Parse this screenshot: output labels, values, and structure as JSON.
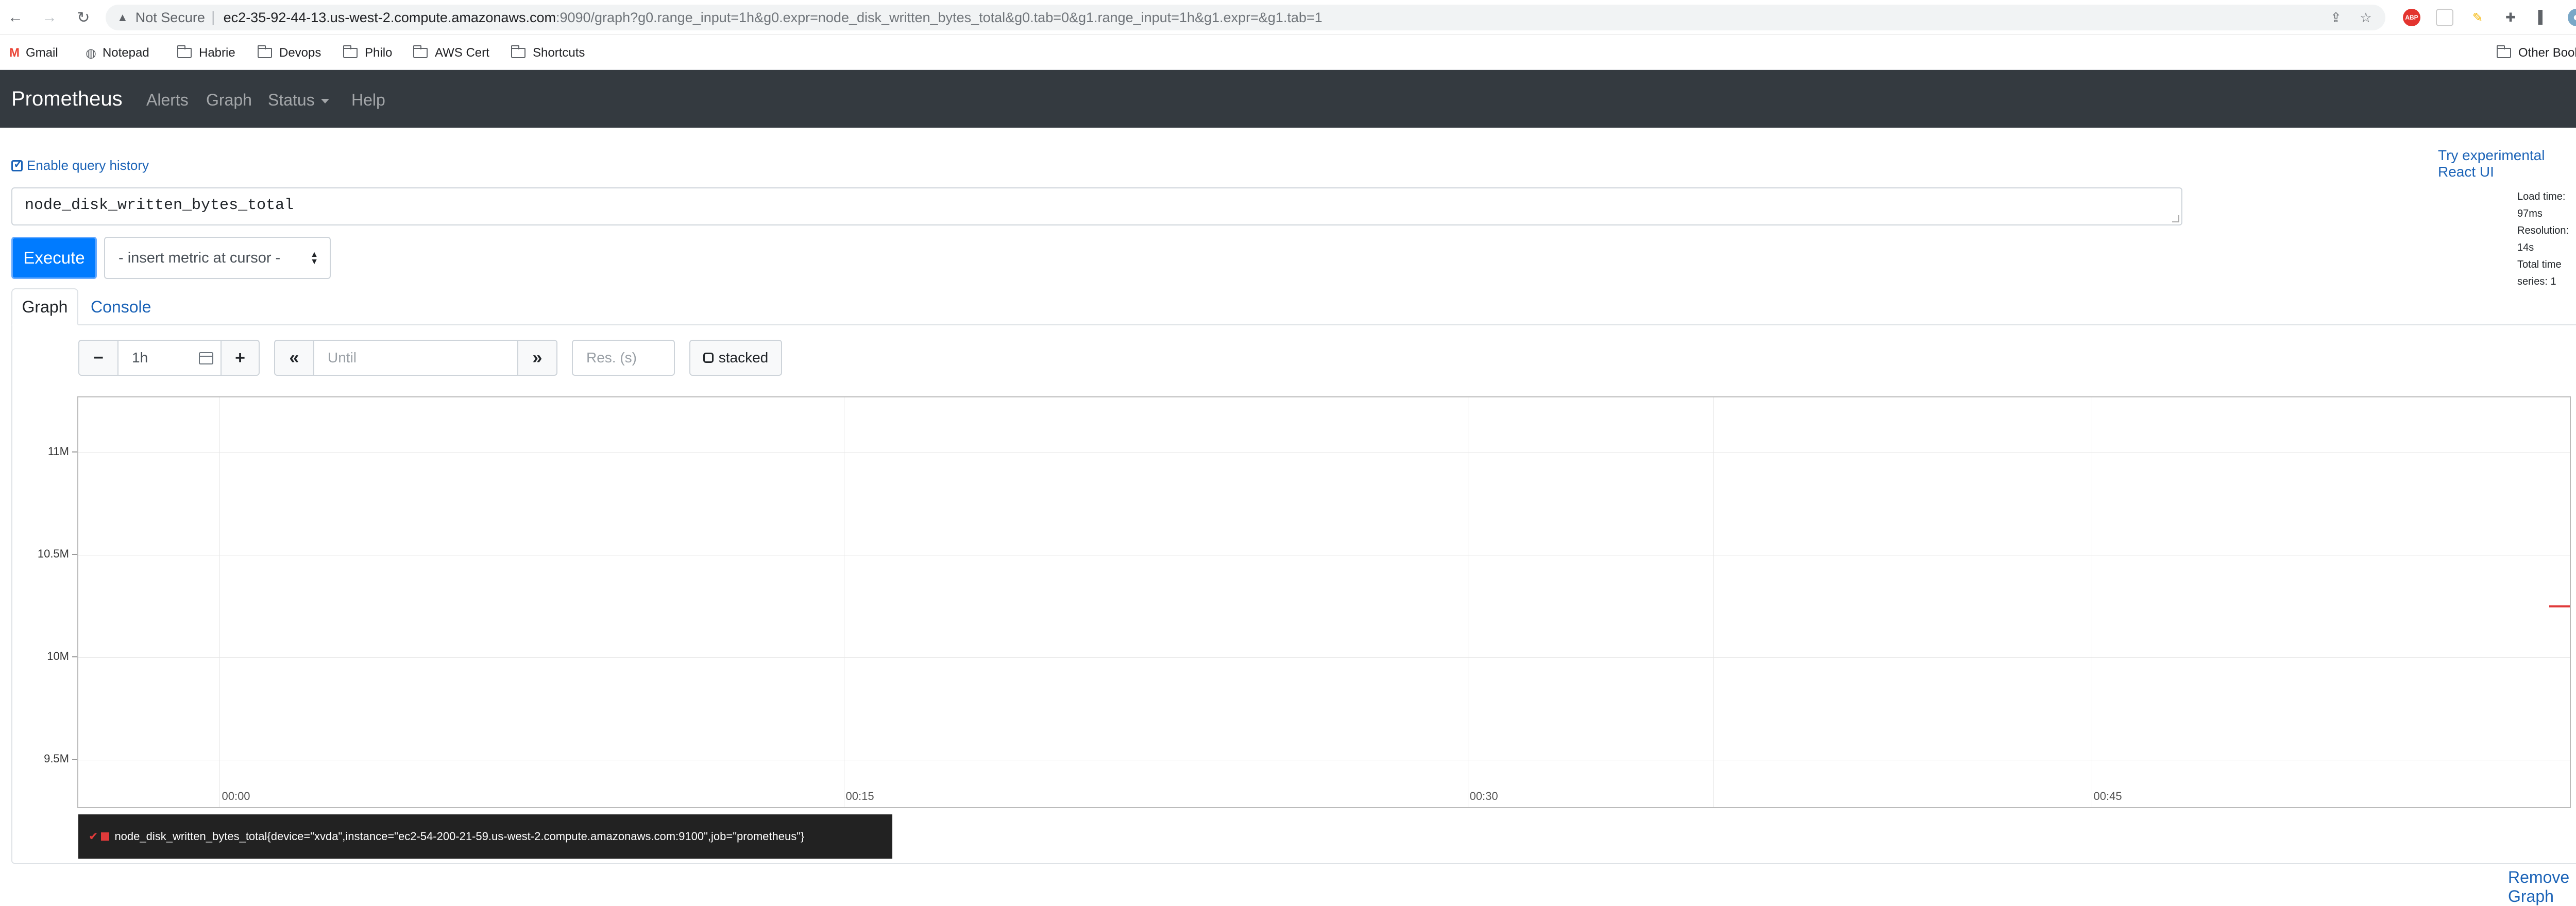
{
  "browser": {
    "security_label": "Not Secure",
    "url_host": "ec2-35-92-44-13.us-west-2.compute.amazonaws.com",
    "url_path": ":9090/graph?g0.range_input=1h&g0.expr=node_disk_written_bytes_total&g0.tab=0&g1.range_input=1h&g1.expr=&g1.tab=1",
    "adblock_label": "ABP"
  },
  "bookmarks": {
    "items": [
      "Gmail",
      "Notepad",
      "Habrie",
      "Devops",
      "Philo",
      "AWS Cert",
      "Shortcuts"
    ],
    "other": "Other Bookmarks"
  },
  "navbar": {
    "brand": "Prometheus",
    "alerts": "Alerts",
    "graph": "Graph",
    "status": "Status",
    "help": "Help"
  },
  "page": {
    "enable_history": "Enable query history",
    "react_link": "Try experimental React UI",
    "stats": {
      "load_time": "Load time: 97ms",
      "resolution": "Resolution: 14s",
      "total_series": "Total time series: 1"
    },
    "expression": "node_disk_written_bytes_total",
    "execute_label": "Execute",
    "insert_metric": "- insert metric at cursor -",
    "tabs": {
      "graph": "Graph",
      "console": "Console"
    },
    "controls": {
      "minus": "−",
      "range": "1h",
      "plus": "+",
      "back": "«",
      "until_placeholder": "Until",
      "forward": "»",
      "res_placeholder": "Res. (s)",
      "stacked": "stacked"
    },
    "legend": "node_disk_written_bytes_total{device=\"xvda\",instance=\"ec2-54-200-21-59.us-west-2.compute.amazonaws.com:9100\",job=\"prometheus\"}",
    "remove_graph": "Remove Graph"
  },
  "colors": {
    "navbar": "#343a40",
    "primary": "#007bff",
    "link": "#1b63b7",
    "series": "#e03a3a"
  },
  "chart_data": {
    "type": "line",
    "ylim": [
      9.27,
      11.27
    ],
    "y_unit": "M",
    "y_ticks": [
      {
        "value": 11.0,
        "label": "11M"
      },
      {
        "value": 10.5,
        "label": "10.5M"
      },
      {
        "value": 10.0,
        "label": "10M"
      },
      {
        "value": 9.5,
        "label": "9.5M"
      }
    ],
    "x_range_minutes": [
      -3.4,
      56.5
    ],
    "x_ticks": [
      {
        "value": 0,
        "label": "00:00"
      },
      {
        "value": 15,
        "label": "00:15"
      },
      {
        "value": 30,
        "label": "00:30"
      },
      {
        "value": 45,
        "label": "00:45"
      }
    ],
    "extra_x_gridlines": [
      35.9
    ],
    "series": [
      {
        "name": "node_disk_written_bytes_total{device=\"xvda\",instance=\"ec2-54-200-21-59.us-west-2.compute.amazonaws.com:9100\",job=\"prometheus\"}",
        "x": [
          56.0,
          56.5
        ],
        "values": [
          10.25,
          10.25
        ]
      }
    ]
  }
}
